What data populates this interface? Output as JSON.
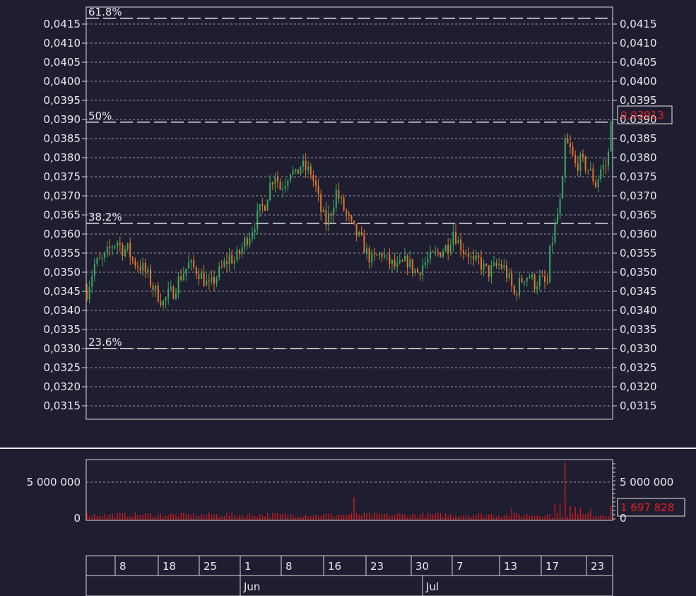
{
  "colors": {
    "background": "#1f1e30",
    "frame": "#d8d8de",
    "grid": "#9a9aa6",
    "up": "#3aa860",
    "down": "#e0762a",
    "volume": "#e01818",
    "last_price": "#e02020",
    "separator": "#e8e8e8"
  },
  "chart_data": [
    {
      "type": "candlestick",
      "title": "",
      "ylim": [
        0.0311,
        0.0418
      ],
      "y_ticks": [
        "0,0415",
        "0,0410",
        "0,0405",
        "0,0400",
        "0,0395",
        "0,0390",
        "0,0385",
        "0,0380",
        "0,0375",
        "0,0370",
        "0,0365",
        "0,0360",
        "0,0355",
        "0,0350",
        "0,0345",
        "0,0340",
        "0,0335",
        "0,0330",
        "0,0325",
        "0,0320",
        "0,0315"
      ],
      "y_tick_values": [
        0.0415,
        0.041,
        0.0405,
        0.04,
        0.0395,
        0.039,
        0.0385,
        0.038,
        0.0375,
        0.037,
        0.0365,
        0.036,
        0.0355,
        0.035,
        0.0345,
        0.034,
        0.0335,
        0.033,
        0.0325,
        0.032,
        0.0315
      ],
      "grid": true,
      "last_price_label": "0,03913",
      "last_price_value": 0.03913,
      "fibonacci_levels": [
        {
          "label": "61.8%",
          "value": 0.04165
        },
        {
          "label": "50%",
          "value": 0.03893
        },
        {
          "label": "38.2%",
          "value": 0.03628
        },
        {
          "label": "23.6%",
          "value": 0.033
        }
      ],
      "close_path": [
        [
          0,
          0.0345
        ],
        [
          3,
          0.0352
        ],
        [
          6,
          0.0353
        ],
        [
          8,
          0.0355
        ],
        [
          10,
          0.0357
        ],
        [
          12,
          0.0358
        ],
        [
          14,
          0.0356
        ],
        [
          16,
          0.0356
        ],
        [
          18,
          0.0353
        ],
        [
          20,
          0.0352
        ],
        [
          22,
          0.0351
        ],
        [
          24,
          0.0349
        ],
        [
          26,
          0.0346
        ],
        [
          28,
          0.0344
        ],
        [
          30,
          0.0342
        ],
        [
          32,
          0.0344
        ],
        [
          34,
          0.0345
        ],
        [
          36,
          0.0348
        ],
        [
          38,
          0.035
        ],
        [
          40,
          0.0352
        ],
        [
          42,
          0.0351
        ],
        [
          44,
          0.035
        ],
        [
          46,
          0.0348
        ],
        [
          48,
          0.0346
        ],
        [
          50,
          0.0348
        ],
        [
          52,
          0.035
        ],
        [
          54,
          0.0352
        ],
        [
          56,
          0.0354
        ],
        [
          58,
          0.0353
        ],
        [
          60,
          0.0355
        ],
        [
          62,
          0.0358
        ],
        [
          64,
          0.036
        ],
        [
          66,
          0.0363
        ],
        [
          68,
          0.0366
        ],
        [
          70,
          0.0368
        ],
        [
          72,
          0.0373
        ],
        [
          74,
          0.0376
        ],
        [
          76,
          0.0372
        ],
        [
          78,
          0.0374
        ],
        [
          80,
          0.0377
        ],
        [
          82,
          0.0375
        ],
        [
          84,
          0.0378
        ],
        [
          86,
          0.0377
        ],
        [
          88,
          0.0376
        ],
        [
          90,
          0.0372
        ],
        [
          92,
          0.0366
        ],
        [
          94,
          0.0363
        ],
        [
          96,
          0.0366
        ],
        [
          98,
          0.0371
        ],
        [
          100,
          0.0368
        ],
        [
          102,
          0.0365
        ],
        [
          104,
          0.0362
        ],
        [
          106,
          0.036
        ],
        [
          108,
          0.0358
        ],
        [
          110,
          0.0355
        ],
        [
          112,
          0.0353
        ],
        [
          114,
          0.0354
        ],
        [
          116,
          0.0355
        ],
        [
          118,
          0.0353
        ],
        [
          120,
          0.0352
        ],
        [
          122,
          0.0351
        ],
        [
          124,
          0.0352
        ],
        [
          126,
          0.0353
        ],
        [
          128,
          0.0351
        ],
        [
          130,
          0.035
        ],
        [
          132,
          0.0352
        ],
        [
          134,
          0.0353
        ],
        [
          136,
          0.0354
        ],
        [
          138,
          0.0355
        ],
        [
          140,
          0.0356
        ],
        [
          142,
          0.0357
        ],
        [
          144,
          0.0361
        ],
        [
          146,
          0.0358
        ],
        [
          148,
          0.0356
        ],
        [
          150,
          0.0355
        ],
        [
          152,
          0.0352
        ],
        [
          154,
          0.0353
        ],
        [
          156,
          0.0351
        ],
        [
          158,
          0.035
        ],
        [
          160,
          0.0351
        ],
        [
          162,
          0.0352
        ],
        [
          164,
          0.0351
        ],
        [
          166,
          0.0348
        ],
        [
          168,
          0.0344
        ],
        [
          170,
          0.0347
        ],
        [
          172,
          0.0349
        ],
        [
          174,
          0.0349
        ],
        [
          176,
          0.0347
        ],
        [
          178,
          0.0348
        ],
        [
          180,
          0.0347
        ],
        [
          181,
          0.0347
        ],
        [
          182,
          0.0355
        ],
        [
          184,
          0.0362
        ],
        [
          186,
          0.0368
        ],
        [
          187,
          0.0373
        ],
        [
          188,
          0.0384
        ],
        [
          190,
          0.0382
        ],
        [
          192,
          0.0378
        ],
        [
          194,
          0.0379
        ],
        [
          196,
          0.0378
        ],
        [
          198,
          0.0376
        ],
        [
          200,
          0.0373
        ],
        [
          202,
          0.0377
        ],
        [
          204,
          0.0378
        ],
        [
          205,
          0.0381
        ],
        [
          206,
          0.0391
        ]
      ]
    },
    {
      "type": "bar",
      "title": "",
      "ylim": [
        0,
        9000000
      ],
      "y_ticks": [
        "5 000 000",
        "0"
      ],
      "y_tick_values": [
        5000000,
        0
      ],
      "last_volume_label": "1 697 828",
      "last_volume_value": 1697828,
      "spikes": [
        {
          "x": 105,
          "value": 2900000
        },
        {
          "x": 167,
          "value": 1300000
        },
        {
          "x": 184,
          "value": 2000000
        },
        {
          "x": 186,
          "value": 2100000
        },
        {
          "x": 188,
          "value": 7800000
        },
        {
          "x": 190,
          "value": 1700000
        },
        {
          "x": 192,
          "value": 1600000
        },
        {
          "x": 194,
          "value": 1400000
        },
        {
          "x": 198,
          "value": 1300000
        },
        {
          "x": 206,
          "value": 1697828
        }
      ]
    }
  ],
  "time_axis": {
    "days": [
      "8",
      "18",
      "25",
      "1",
      "8",
      "16",
      "23",
      "30",
      "7",
      "13",
      "17",
      "23"
    ],
    "months": [
      "Jun",
      "Jul"
    ]
  }
}
